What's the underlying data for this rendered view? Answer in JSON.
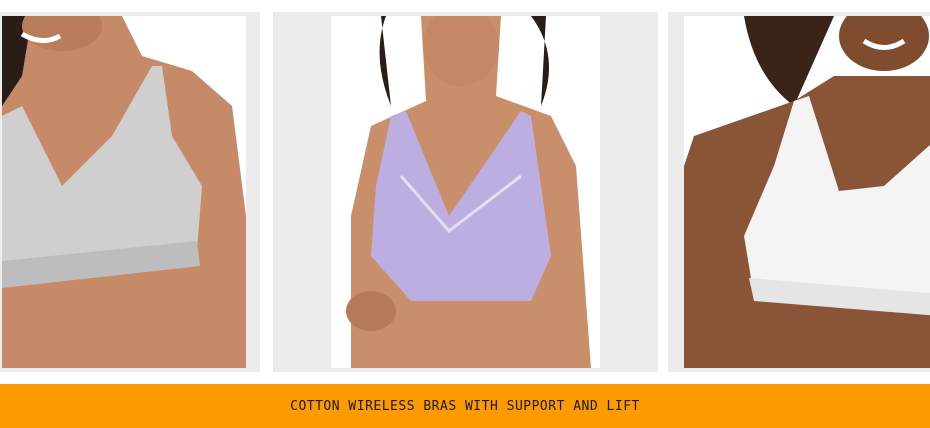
{
  "products": [
    {
      "id": "gray",
      "color": "#cfcfcf",
      "skin": "#c68a68"
    },
    {
      "id": "lavender",
      "color": "#bcaee0",
      "skin": "#c98f6b"
    },
    {
      "id": "white",
      "color": "#f4f4f4",
      "skin": "#8a5536"
    }
  ],
  "banner": {
    "text": "COTTON WIRELESS BRAS WITH SUPPORT AND LIFT",
    "background": "#fd9a00"
  }
}
